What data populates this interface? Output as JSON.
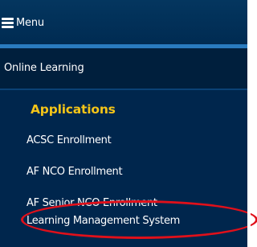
{
  "menu": {
    "label": "Menu",
    "icon": "hamburger-menu-icon"
  },
  "nav": {
    "online_learning": "Online Learning",
    "section_title": "Applications",
    "items": [
      {
        "label": "ACSC Enrollment"
      },
      {
        "label": "AF NCO Enrollment"
      },
      {
        "label": "AF Senior NCO Enrollment"
      },
      {
        "label": "Learning Management System"
      }
    ]
  },
  "colors": {
    "background": "#00264d",
    "accent_bar": "#2a7bbf",
    "section_title": "#f5c518",
    "highlight_circle": "#e0101a"
  }
}
